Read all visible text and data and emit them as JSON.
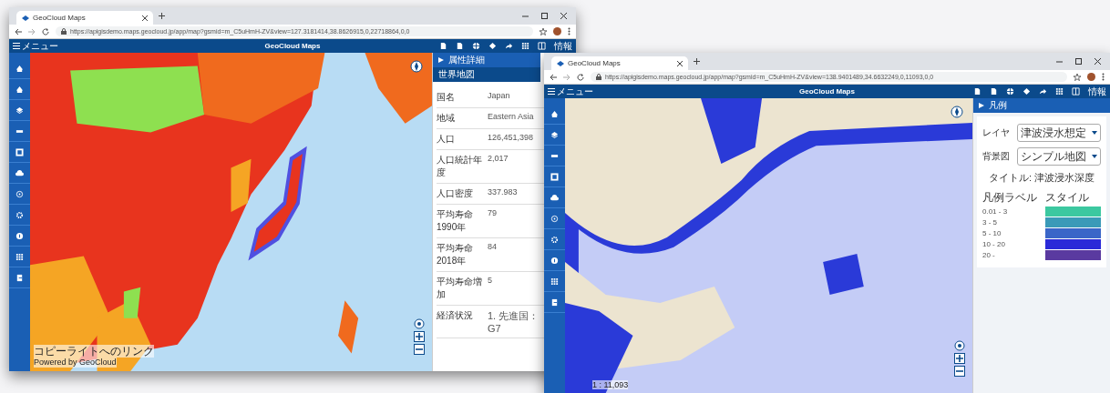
{
  "windows": [
    {
      "tab": {
        "title": "GeoCloud Maps"
      },
      "url": "https://apigisdemo.maps.geocloud.jp/app/map?gsmid=m_C5uHmH-ZV&view=127.3181414,38.8626915,0,22718864,0,0",
      "menu": "メニュー",
      "app_title": "GeoCloud Maps",
      "header_right": "情報",
      "map": {
        "kind": "world",
        "attribution": [
          "コピーライトへのリンク",
          "Powered by GeoCloud"
        ]
      },
      "panel": {
        "kind": "attributes",
        "section": "属性詳細",
        "subtitle": "世界地図",
        "rows": [
          {
            "label": "国名",
            "value": "Japan"
          },
          {
            "label": "地域",
            "value": "Eastern Asia"
          },
          {
            "label": "人口",
            "value": "126,451,398"
          },
          {
            "label": "人口統計年度",
            "value": "2,017"
          },
          {
            "label": "人口密度",
            "value": "337.983"
          },
          {
            "label": "平均寿命1990年",
            "value": "79"
          },
          {
            "label": "平均寿命2018年",
            "value": "84"
          },
          {
            "label": "平均寿命増加",
            "value": "5"
          },
          {
            "label": "経済状況",
            "value": "1. 先進国：G7"
          }
        ]
      }
    },
    {
      "tab": {
        "title": "GeoCloud Maps"
      },
      "url": "https://apigisdemo.maps.geocloud.jp/app/map?gsmid=m_C5uHmH-ZV&view=138.9401489,34.6632249,0,11093,0,0",
      "menu": "メニュー",
      "app_title": "GeoCloud Maps",
      "header_right": "情報",
      "map": {
        "kind": "coast",
        "scale": "1 : 11,093"
      },
      "panel": {
        "kind": "legend",
        "section": "凡例",
        "fields": [
          {
            "label": "レイヤ",
            "value": "津波浸水想定"
          },
          {
            "label": "背景図",
            "value": "シンプル地図"
          }
        ],
        "legend_title": "タイトル: 津波浸水深度",
        "label_heading": "凡例ラベル",
        "style_heading": "スタイル",
        "items": [
          {
            "label": "0.01 - 3",
            "color": "#3cc8a0"
          },
          {
            "label": "3 - 5",
            "color": "#3a9ab8"
          },
          {
            "label": "5 - 10",
            "color": "#3a66c8"
          },
          {
            "label": "10 - 20",
            "color": "#2a2ad8"
          },
          {
            "label": "20 -",
            "color": "#5a3aa0"
          }
        ]
      }
    }
  ]
}
